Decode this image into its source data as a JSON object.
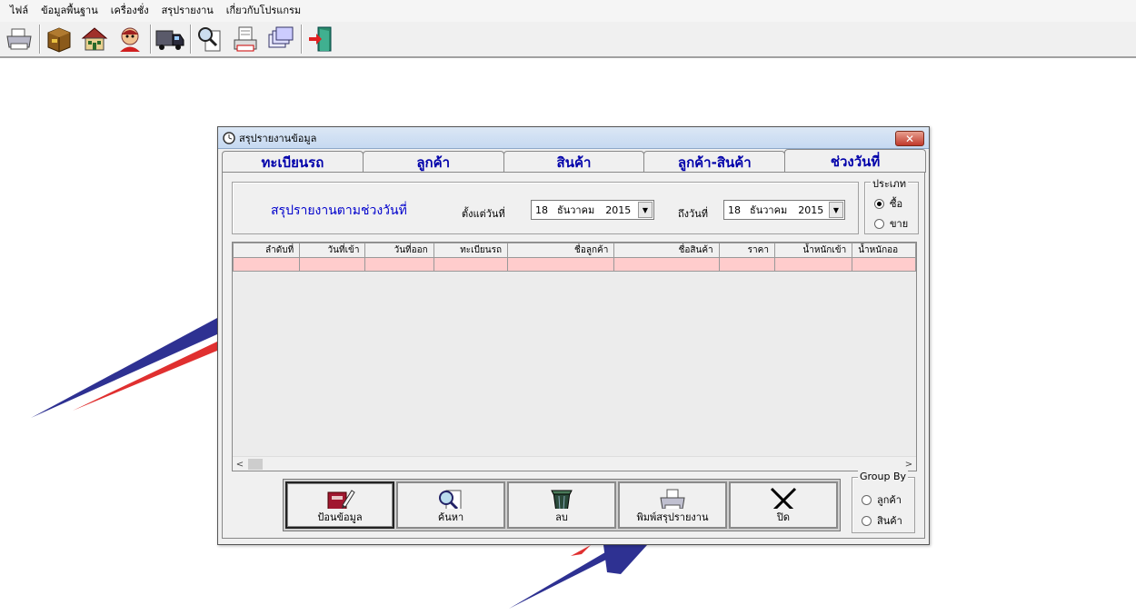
{
  "menubar": {
    "items": [
      "ไฟล์",
      "ข้อมูลพื้นฐาน",
      "เครื่องชั่ง",
      "สรุปรายงาน",
      "เกี่ยวกับโปรแกรม"
    ]
  },
  "toolbar": {
    "buttons": [
      "printer-icon",
      "box-icon",
      "house-icon",
      "person-icon",
      "truck-icon",
      "search-doc-icon",
      "print-doc-icon",
      "report-stack-icon",
      "exit-door-icon"
    ]
  },
  "dialog": {
    "title": "สรุปรายงานข้อมูล",
    "close": "✕",
    "tabs": [
      "ทะเบียนรถ",
      "ลูกค้า",
      "สินค้า",
      "ลูกค้า-สินค้า",
      "ช่วงวันที่"
    ],
    "active_tab": 4,
    "report_title": "สรุปรายงานตามช่วงวันที่",
    "from_label": "ตั้งแต่วันที่",
    "from_date": {
      "day": "18",
      "month": "ธันวาคม",
      "year": "2015"
    },
    "to_label": "ถึงวันที่",
    "to_date": {
      "day": "18",
      "month": "ธันวาคม",
      "year": "2015"
    },
    "type_group": {
      "legend": "ประเภท",
      "options": [
        "ซื้อ",
        "ขาย"
      ],
      "selected": 0
    },
    "grid": {
      "columns": [
        "ลำดับที่",
        "วันที่เข้า",
        "วันที่ออก",
        "ทะเบียนรถ",
        "ชื่อลูกค้า",
        "ชื่อสินค้า",
        "ราคา",
        "น้ำหนักเข้า",
        "น้ำหนักออ"
      ]
    },
    "buttons": [
      {
        "label": "ป้อนข้อมูล",
        "icon": "edit-book-icon"
      },
      {
        "label": "ค้นหา",
        "icon": "magnifier-doc-icon"
      },
      {
        "label": "ลบ",
        "icon": "trash-bin-icon"
      },
      {
        "label": "พิมพ์สรุปรายงาน",
        "icon": "printer-icon"
      },
      {
        "label": "ปิด",
        "icon": "close-x-icon"
      }
    ],
    "group_by": {
      "legend": "Group By",
      "options": [
        "ลูกค้า",
        "สินค้า"
      ]
    }
  }
}
